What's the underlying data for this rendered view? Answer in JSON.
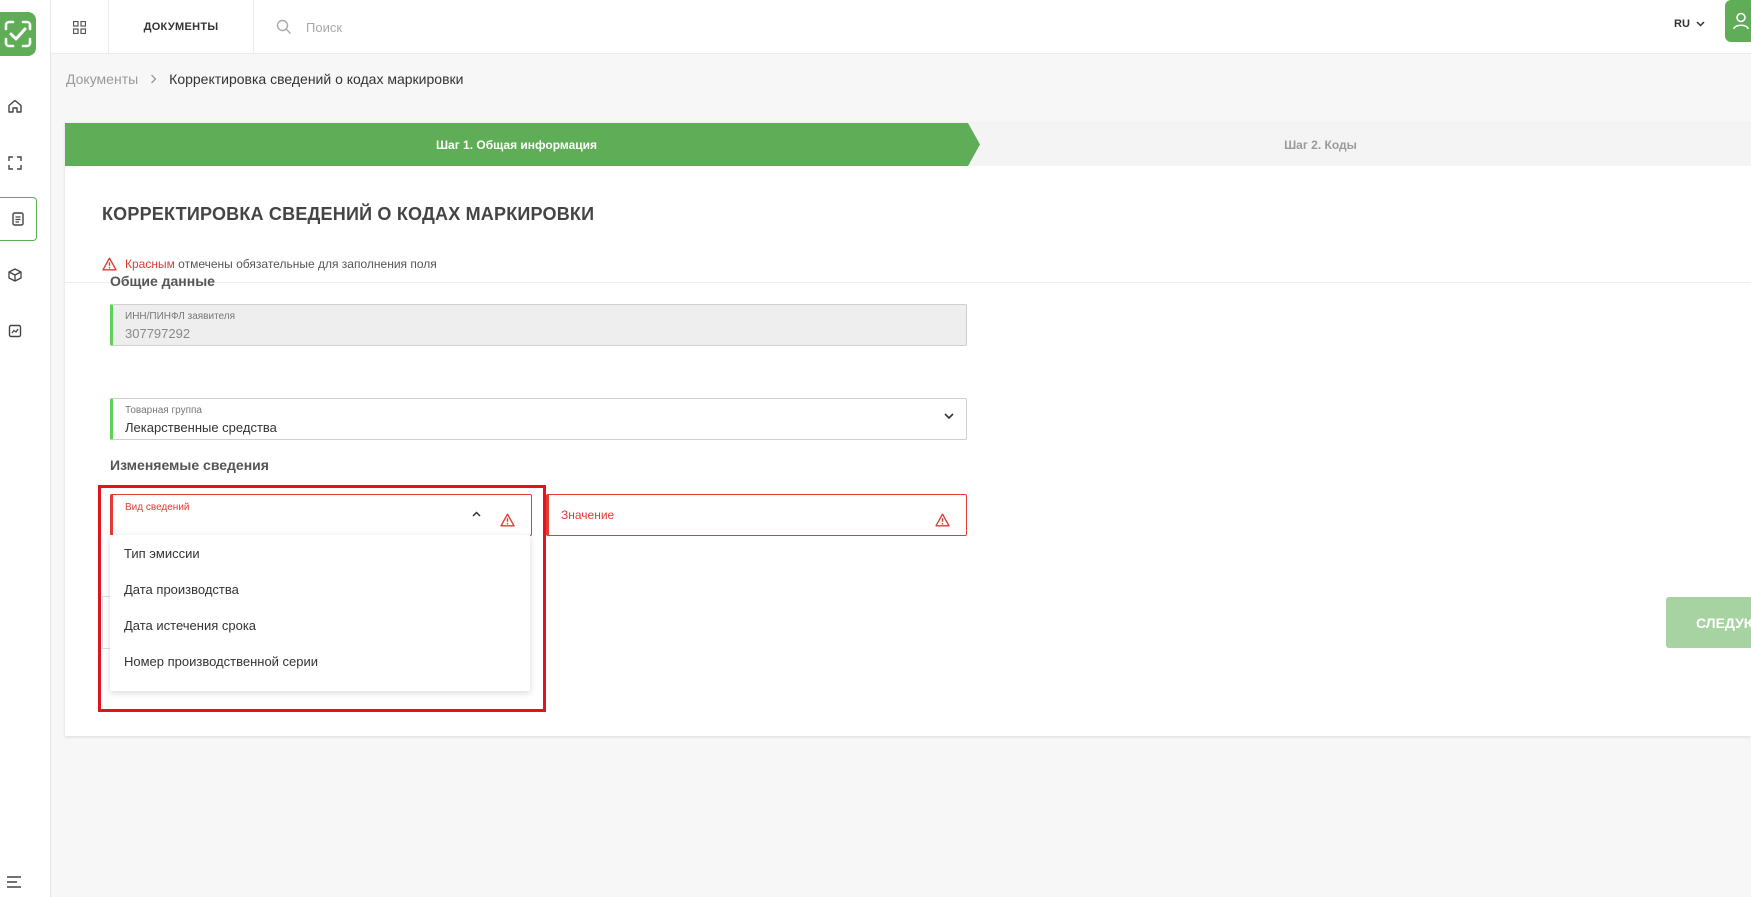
{
  "topbar": {
    "docs_tab": "ДОКУМЕНТЫ",
    "search_placeholder": "Поиск",
    "lang": "RU"
  },
  "breadcrumb": {
    "root": "Документы",
    "current": "Корректировка сведений о кодах маркировки"
  },
  "steps": {
    "step1": "Шаг 1. Общая информация",
    "step2": "Шаг 2. Коды"
  },
  "form": {
    "title": "КОРРЕКТИРОВКА СВЕДЕНИЙ О КОДАХ МАРКИРОВКИ",
    "required_red": "Красным",
    "required_rest": " отмечены обязательные для заполнения поля",
    "general_section": "Общие данные",
    "inn_label": "ИНН/ПИНФЛ заявителя",
    "inn_value": "307797292",
    "group_label": "Товарная группа",
    "group_value": "Лекарственные средства",
    "changes_section": "Изменяемые сведения",
    "info_type_label": "Вид сведений",
    "value_placeholder": "Значение",
    "options": [
      "Тип эмиссии",
      "Дата производства",
      "Дата истечения срока",
      "Номер производственной серии"
    ],
    "next_button": "СЛЕДУЮЩИЙ"
  },
  "colors": {
    "accent": "#5fad56",
    "error": "#e53935",
    "highlight": "#e0141e"
  }
}
